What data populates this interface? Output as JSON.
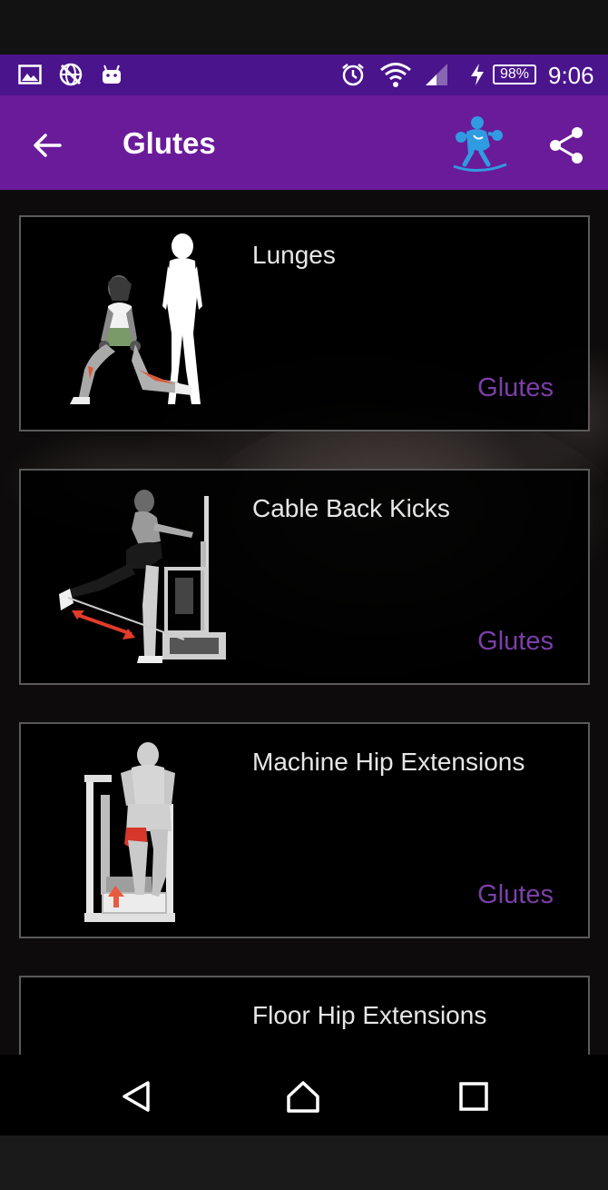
{
  "status_bar": {
    "icons": [
      "image-icon",
      "no-network-globe-icon",
      "android-icon",
      "alarm-icon",
      "wifi-icon",
      "signal-icon",
      "charging-icon"
    ],
    "battery": "98%",
    "time": "9:06"
  },
  "app_bar": {
    "title": "Glutes",
    "back_icon": "arrow-left-icon",
    "logo_icon": "fitness-logo-icon",
    "share_icon": "share-icon",
    "colors": {
      "bar": "#6a1b9a",
      "status": "#4a148c",
      "accent": "#7b3fa8"
    }
  },
  "exercises": [
    {
      "name": "Lunges",
      "muscle": "Glutes"
    },
    {
      "name": "Cable Back Kicks",
      "muscle": "Glutes"
    },
    {
      "name": "Machine Hip Extensions",
      "muscle": "Glutes"
    },
    {
      "name": "Floor Hip Extensions",
      "muscle": ""
    }
  ],
  "nav_bar": {
    "icons": [
      "back-triangle-icon",
      "home-icon",
      "recents-square-icon"
    ]
  }
}
